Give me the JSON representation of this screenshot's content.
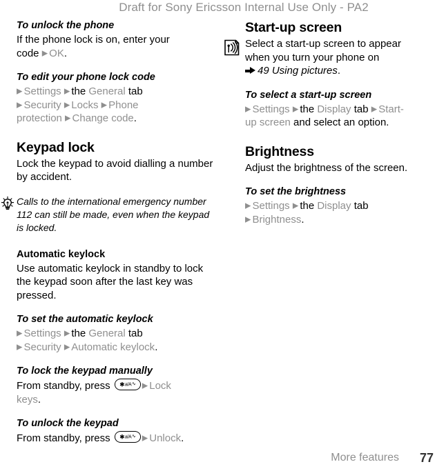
{
  "header": {
    "watermark": "Draft for Sony Ericsson Internal Use Only - PA2"
  },
  "footer": {
    "section": "More features",
    "page_number": "77"
  },
  "icons": {
    "tip": "lightbulb-icon",
    "note": "note-signal-icon",
    "xref": "cross-reference-arrow-icon",
    "menu_separator": "menu-arrow-icon",
    "star_key": "star-key-icon"
  },
  "glyphs": {
    "menu_arrow": "▶",
    "key_star": "✱",
    "key_label": "a/A",
    "key_tail": "∿"
  },
  "left_column": {
    "blocks": [
      {
        "type": "procedure",
        "heading": "To unlock the phone",
        "lines": [
          [
            {
              "text": "If the phone lock is on, enter your",
              "style": "plain"
            }
          ],
          [
            {
              "text": "code ",
              "style": "plain"
            },
            {
              "text": "OK",
              "style": "menu",
              "arrow": true
            },
            {
              "text": ".",
              "style": "plain"
            }
          ]
        ]
      },
      {
        "type": "procedure",
        "heading": "To edit your phone lock code",
        "lines": [
          [
            {
              "text": "Settings ",
              "style": "menu",
              "arrow": true
            },
            {
              "text": "the ",
              "style": "plain",
              "arrow": true
            },
            {
              "text": "General",
              "style": "menu"
            },
            {
              "text": " tab",
              "style": "plain"
            }
          ],
          [
            {
              "text": "Security ",
              "style": "menu",
              "arrow": true
            },
            {
              "text": "Locks ",
              "style": "menu",
              "arrow": true
            },
            {
              "text": "Phone",
              "style": "menu",
              "arrow": true
            }
          ],
          [
            {
              "text": "protection ",
              "style": "menu"
            },
            {
              "text": "Change code",
              "style": "menu",
              "arrow": true
            },
            {
              "text": ".",
              "style": "plain"
            }
          ]
        ]
      },
      {
        "type": "section",
        "heading": "Keypad lock",
        "body": "Lock the keypad to avoid dialling a number by accident."
      },
      {
        "type": "tip",
        "icon": "lightbulb-icon",
        "text": "Calls to the international emergency number 112 can still be made, even when the keypad is locked."
      },
      {
        "type": "subsection",
        "heading": "Automatic keylock",
        "body": "Use automatic keylock in standby to lock the keypad soon after the last key was pressed."
      },
      {
        "type": "procedure",
        "heading": "To set the automatic keylock",
        "lines": [
          [
            {
              "text": "Settings ",
              "style": "menu",
              "arrow": true
            },
            {
              "text": "the ",
              "style": "plain",
              "arrow": true
            },
            {
              "text": "General",
              "style": "menu"
            },
            {
              "text": " tab",
              "style": "plain"
            }
          ],
          [
            {
              "text": "Security ",
              "style": "menu",
              "arrow": true
            },
            {
              "text": "Automatic keylock",
              "style": "menu",
              "arrow": true
            },
            {
              "text": ".",
              "style": "plain"
            }
          ]
        ]
      },
      {
        "type": "procedure_key",
        "heading": "To lock the keypad manually",
        "prefix": "From standby, press ",
        "key": "star-key-icon",
        "lines": [
          [
            {
              "text": "Lock",
              "style": "menu",
              "arrow": true
            }
          ],
          [
            {
              "text": "keys",
              "style": "menu"
            },
            {
              "text": ".",
              "style": "plain"
            }
          ]
        ]
      },
      {
        "type": "procedure_key",
        "heading": "To unlock the keypad",
        "prefix": "From standby, press ",
        "key": "star-key-icon",
        "lines": [
          [
            {
              "text": "Unlock",
              "style": "menu",
              "arrow": true
            },
            {
              "text": ".",
              "style": "plain"
            }
          ]
        ]
      }
    ]
  },
  "right_column": {
    "blocks": [
      {
        "type": "section_note",
        "heading": "Start-up screen",
        "icon": "note-signal-icon",
        "body_lines": [
          "Select a start-up screen to appear",
          "when you turn your phone on"
        ],
        "xref": "49 Using pictures",
        "xref_suffix": "."
      },
      {
        "type": "procedure",
        "heading": "To select a start-up screen",
        "lines": [
          [
            {
              "text": "Settings ",
              "style": "menu",
              "arrow": true
            },
            {
              "text": "the ",
              "style": "plain",
              "arrow": true
            },
            {
              "text": "Display",
              "style": "menu"
            },
            {
              "text": " tab ",
              "style": "plain"
            },
            {
              "text": "Start-",
              "style": "menu",
              "arrow": true
            }
          ],
          [
            {
              "text": "up screen",
              "style": "menu"
            },
            {
              "text": " and select an option.",
              "style": "plain"
            }
          ]
        ]
      },
      {
        "type": "section",
        "heading": "Brightness",
        "body": "Adjust the brightness of the screen."
      },
      {
        "type": "procedure",
        "heading": "To set the brightness",
        "lines": [
          [
            {
              "text": "Settings ",
              "style": "menu",
              "arrow": true
            },
            {
              "text": "the ",
              "style": "plain",
              "arrow": true
            },
            {
              "text": "Display",
              "style": "menu"
            },
            {
              "text": " tab",
              "style": "plain"
            }
          ],
          [
            {
              "text": "Brightness",
              "style": "menu",
              "arrow": true
            },
            {
              "text": ".",
              "style": "plain"
            }
          ]
        ]
      }
    ]
  }
}
